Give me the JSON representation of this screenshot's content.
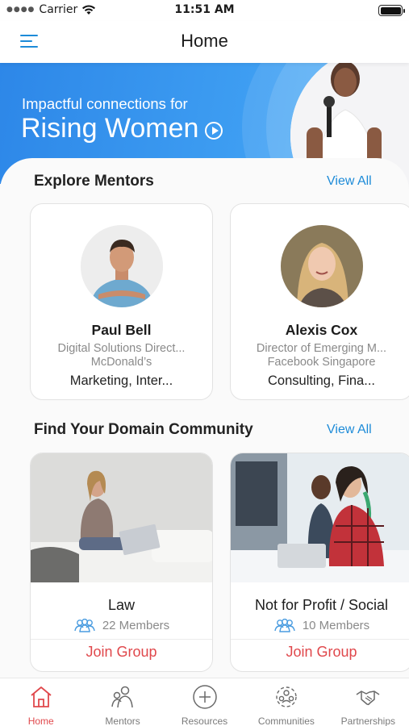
{
  "status_bar": {
    "carrier": "Carrier",
    "time": "11:51 AM"
  },
  "header": {
    "title": "Home"
  },
  "banner": {
    "line1": "Impactful connections for",
    "line2": "Rising Women"
  },
  "mentors": {
    "title": "Explore Mentors",
    "view_all": "View All",
    "items": [
      {
        "name": "Paul Bell",
        "role": "Digital Solutions Direct...",
        "org": "McDonald’s",
        "skills": "Marketing, Inter..."
      },
      {
        "name": "Alexis Cox",
        "role": "Director of Emerging M...",
        "org": "Facebook Singapore",
        "skills": "Consulting, Fina..."
      }
    ]
  },
  "communities": {
    "title": "Find Your Domain Community",
    "view_all": "View All",
    "items": [
      {
        "name": "Law",
        "members": "22 Members",
        "join": "Join Group"
      },
      {
        "name": "Not for Profit / Social",
        "members": "10 Members",
        "join": "Join Group"
      }
    ]
  },
  "tabs": [
    {
      "label": "Home",
      "icon": "home-icon",
      "active": true
    },
    {
      "label": "Mentors",
      "icon": "mentors-icon",
      "active": false
    },
    {
      "label": "Resources",
      "icon": "plus-circle-icon",
      "active": false
    },
    {
      "label": "Communities",
      "icon": "communities-icon",
      "active": false
    },
    {
      "label": "Partnerships",
      "icon": "handshake-icon",
      "active": false
    }
  ],
  "colors": {
    "accent_blue": "#1d8bd8",
    "accent_red": "#e0484c",
    "banner_blue": "#3e9ef2"
  }
}
